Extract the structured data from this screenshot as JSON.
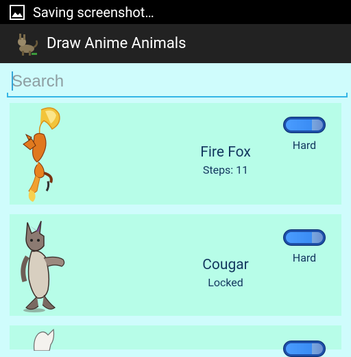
{
  "status_bar": {
    "text": "Saving screenshot…",
    "icon": "image-icon"
  },
  "action_bar": {
    "title": "Draw Anime Animals",
    "icon": "app-animal-icon"
  },
  "search": {
    "placeholder": "Search",
    "value": ""
  },
  "items": [
    {
      "name": "Fire Fox",
      "status": "Steps: 11",
      "difficulty": "Hard"
    },
    {
      "name": "Cougar",
      "status": "Locked",
      "difficulty": "Hard"
    }
  ],
  "colors": {
    "list_bg": "#cffcfc",
    "card_bg": "#b7fde8",
    "accent": "#33b5e5",
    "action_bar": "#222222",
    "text": "#12365e"
  }
}
